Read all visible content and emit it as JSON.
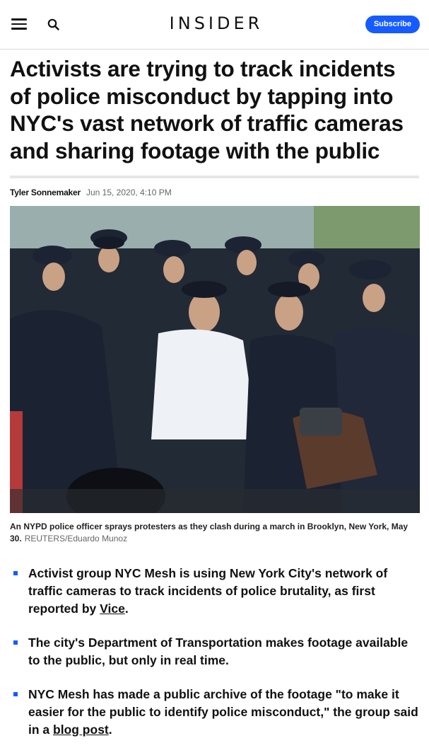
{
  "header": {
    "logo": "INSIDER",
    "subscribe_label": "Subscribe",
    "accent_color": "#155bff"
  },
  "article": {
    "headline": "Activists are trying to track incidents of police misconduct by tapping into NYC's vast network of traffic cameras and sharing footage with the public",
    "author": "Tyler Sonnemaker",
    "date": "Jun 15, 2020, 4:10 PM",
    "image": {
      "caption": "An NYPD police officer sprays protesters as they clash during a march in Brooklyn, New York, May 30.",
      "credit": "REUTERS/Eduardo Munoz"
    },
    "bullets": [
      {
        "text_before": "Activist group NYC Mesh is using New York City's network of traffic cameras to track incidents of police brutality, as first reported by ",
        "link": "Vice",
        "text_after": "."
      },
      {
        "text_before": "The city's Department of Transportation makes footage available to the public, but only in real time.",
        "link": "",
        "text_after": ""
      },
      {
        "text_before": "NYC Mesh has made a public archive of the footage \"to make it easier for the public to identify police misconduct,\" the group said in a ",
        "link": "blog post",
        "text_after": "."
      }
    ]
  }
}
